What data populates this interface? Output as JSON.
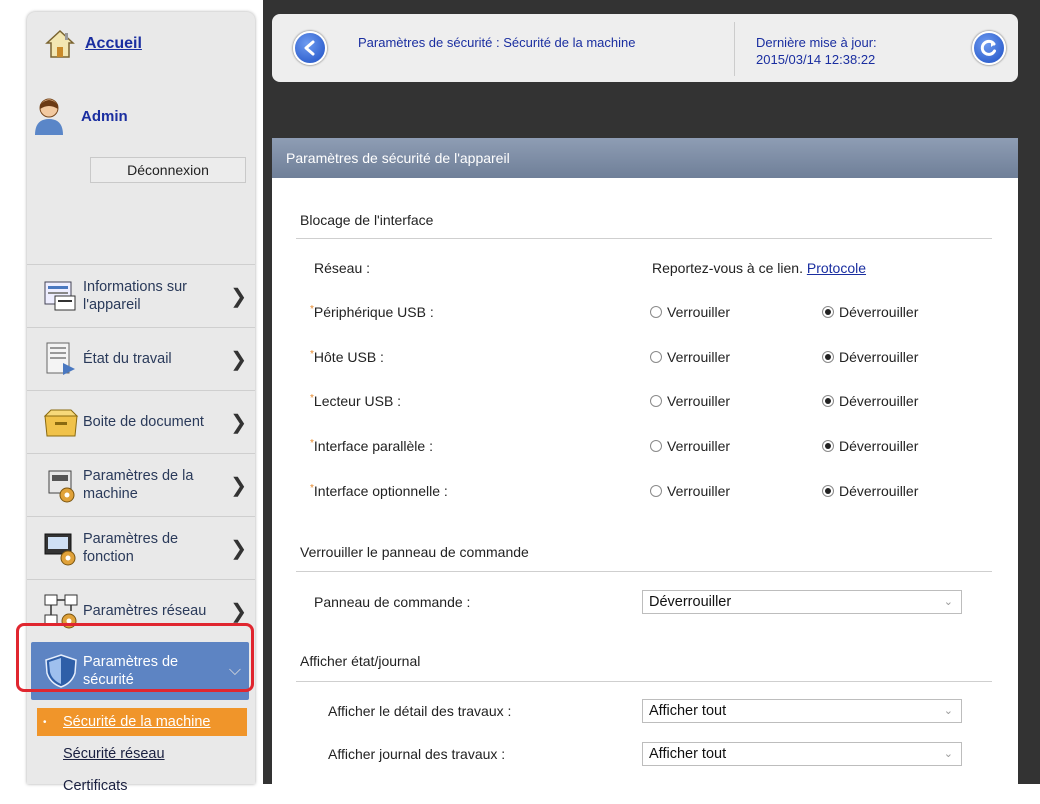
{
  "sidebar": {
    "home_label": "Accueil",
    "user_name": "Admin",
    "logout_label": "Déconnexion",
    "items": [
      {
        "label": "Informations sur l'appareil",
        "icon": "device-info-icon"
      },
      {
        "label": "État du travail",
        "icon": "job-status-icon"
      },
      {
        "label": "Boite de document",
        "icon": "document-box-icon"
      },
      {
        "label": "Paramètres de la machine",
        "icon": "machine-settings-icon"
      },
      {
        "label": "Paramètres de fonction",
        "icon": "function-settings-icon"
      },
      {
        "label": "Paramètres réseau",
        "icon": "network-settings-icon"
      },
      {
        "label": "Paramètres de sécurité",
        "icon": "security-shield-icon"
      }
    ],
    "submenu": [
      "Sécurité de la machine",
      "Sécurité réseau",
      "Certificats"
    ]
  },
  "header": {
    "title": "Paramètres de sécurité : Sécurité de la machine",
    "last_update_label": "Dernière mise à jour:",
    "last_update_value": "2015/03/14 12:38:22"
  },
  "panel": {
    "title": "Paramètres de sécurité de l'appareil",
    "interface_block": {
      "title": "Blocage de l'interface",
      "network_label": "Réseau :",
      "network_text": "Reportez-vous à ce lien.",
      "network_link": "Protocole",
      "lock_label": "Verrouiller",
      "unlock_label": "Déverrouiller",
      "rows": [
        {
          "label": "Périphérique USB :",
          "selected": "Déverrouiller"
        },
        {
          "label": "Hôte USB :",
          "selected": "Déverrouiller"
        },
        {
          "label": "Lecteur USB :",
          "selected": "Déverrouiller"
        },
        {
          "label": "Interface parallèle :",
          "selected": "Déverrouiller"
        },
        {
          "label": "Interface optionnelle :",
          "selected": "Déverrouiller"
        }
      ]
    },
    "panel_lock": {
      "title": "Verrouiller le panneau de commande",
      "label": "Panneau de commande :",
      "value": "Déverrouiller"
    },
    "status_log": {
      "title": "Afficher état/journal",
      "rows": [
        {
          "label": "Afficher le détail des travaux :",
          "value": "Afficher tout"
        },
        {
          "label": "Afficher journal des travaux :",
          "value": "Afficher tout"
        }
      ]
    }
  },
  "colors": {
    "link": "#1a2ea0",
    "active_menu": "#5d84c3",
    "current_submenu": "#f0952a",
    "highlight_frame": "#e0262f",
    "required_marker": "#e58a2f"
  }
}
